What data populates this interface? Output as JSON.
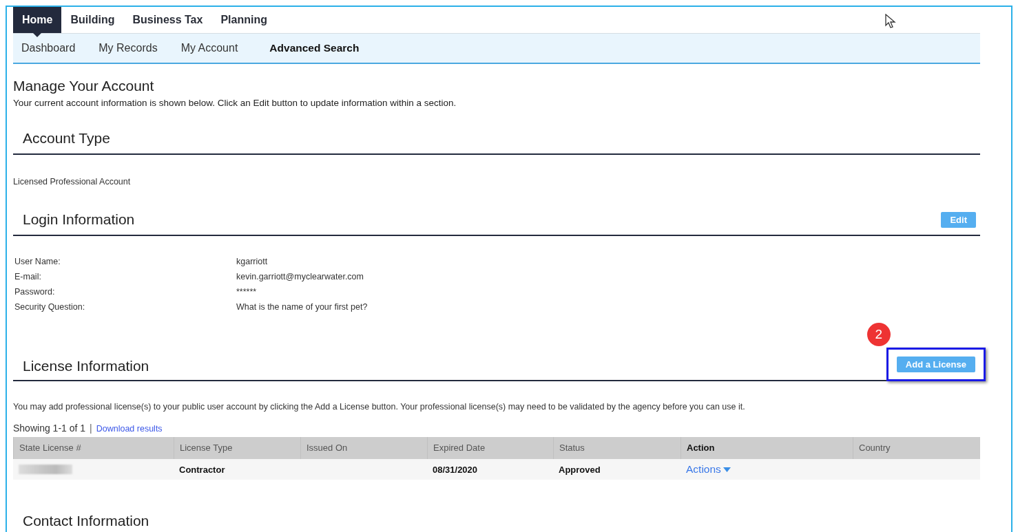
{
  "tabs": [
    {
      "label": "Home",
      "selected": true
    },
    {
      "label": "Building",
      "selected": false
    },
    {
      "label": "Business Tax",
      "selected": false
    },
    {
      "label": "Planning",
      "selected": false
    }
  ],
  "subnav": [
    {
      "label": "Dashboard",
      "emphasis": false
    },
    {
      "label": "My Records",
      "emphasis": false
    },
    {
      "label": "My Account",
      "emphasis": false
    },
    {
      "label": "Advanced Search",
      "emphasis": true
    }
  ],
  "page": {
    "title": "Manage Your Account",
    "intro": "Your current account information is shown below. Click an Edit button to update information within a section."
  },
  "account_type": {
    "title": "Account Type",
    "value": "Licensed Professional Account"
  },
  "login": {
    "title": "Login Information",
    "edit_button": "Edit",
    "fields": [
      {
        "label": "User Name:",
        "value": "kgarriott"
      },
      {
        "label": "E-mail:",
        "value": "kevin.garriott@myclearwater.com"
      },
      {
        "label": "Password:",
        "value": "******"
      },
      {
        "label": "Security Question:",
        "value": "What is the name of your first pet?"
      }
    ]
  },
  "license": {
    "title": "License Information",
    "callout": "2",
    "add_button": "Add a License",
    "highlighted": true,
    "intro": "You may add professional license(s) to your public user account by clicking the Add a License button. Your professional license(s) may need to be validated by the agency before you can use it.",
    "showing": "Showing 1-1 of 1",
    "separator": "|",
    "download_link": "Download results",
    "columns": [
      {
        "label": "State License #",
        "bold": false
      },
      {
        "label": "License Type",
        "bold": false
      },
      {
        "label": "Issued On",
        "bold": false
      },
      {
        "label": "Expired Date",
        "bold": false
      },
      {
        "label": "Status",
        "bold": false
      },
      {
        "label": "Action",
        "bold": true
      },
      {
        "label": "Country",
        "bold": false
      }
    ],
    "rows": [
      {
        "redacted": true,
        "license_type": "Contractor",
        "expired_date": "08/31/2020",
        "status": "Approved",
        "action": "Actions"
      }
    ]
  },
  "contact": {
    "title": "Contact Information"
  }
}
